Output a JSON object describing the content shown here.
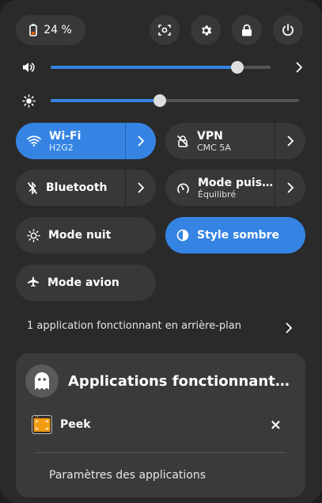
{
  "top": {
    "battery": "24 %",
    "buttons": [
      {
        "name": "screenshot-button",
        "icon": "screenshot-icon"
      },
      {
        "name": "settings-button",
        "icon": "gear-icon"
      },
      {
        "name": "lock-button",
        "icon": "lock-icon"
      },
      {
        "name": "power-button",
        "icon": "power-icon"
      }
    ]
  },
  "volume": {
    "level": 0.85
  },
  "brightness": {
    "level": 0.44
  },
  "tiles": {
    "wifi": {
      "title": "Wi-Fi",
      "sub": "H2G2"
    },
    "vpn": {
      "title": "VPN",
      "sub": "CMC 5A"
    },
    "bluetooth": {
      "title": "Bluetooth"
    },
    "power_mode": {
      "title": "Mode puiss…",
      "sub": "Équilibré"
    },
    "night": {
      "title": "Mode nuit"
    },
    "dark_style": {
      "title": "Style sombre"
    },
    "airplane": {
      "title": "Mode avion"
    }
  },
  "background_apps": {
    "label": "1 application fonctionnant en arrière-plan"
  },
  "card": {
    "title": "Applications fonctionnant en arrière-plan",
    "app": "Peek",
    "close": "×",
    "settings": "Paramètres des applications"
  },
  "colors": {
    "accent": "#3584e4",
    "panel": "#2a2a2a",
    "tile": "#383838"
  }
}
